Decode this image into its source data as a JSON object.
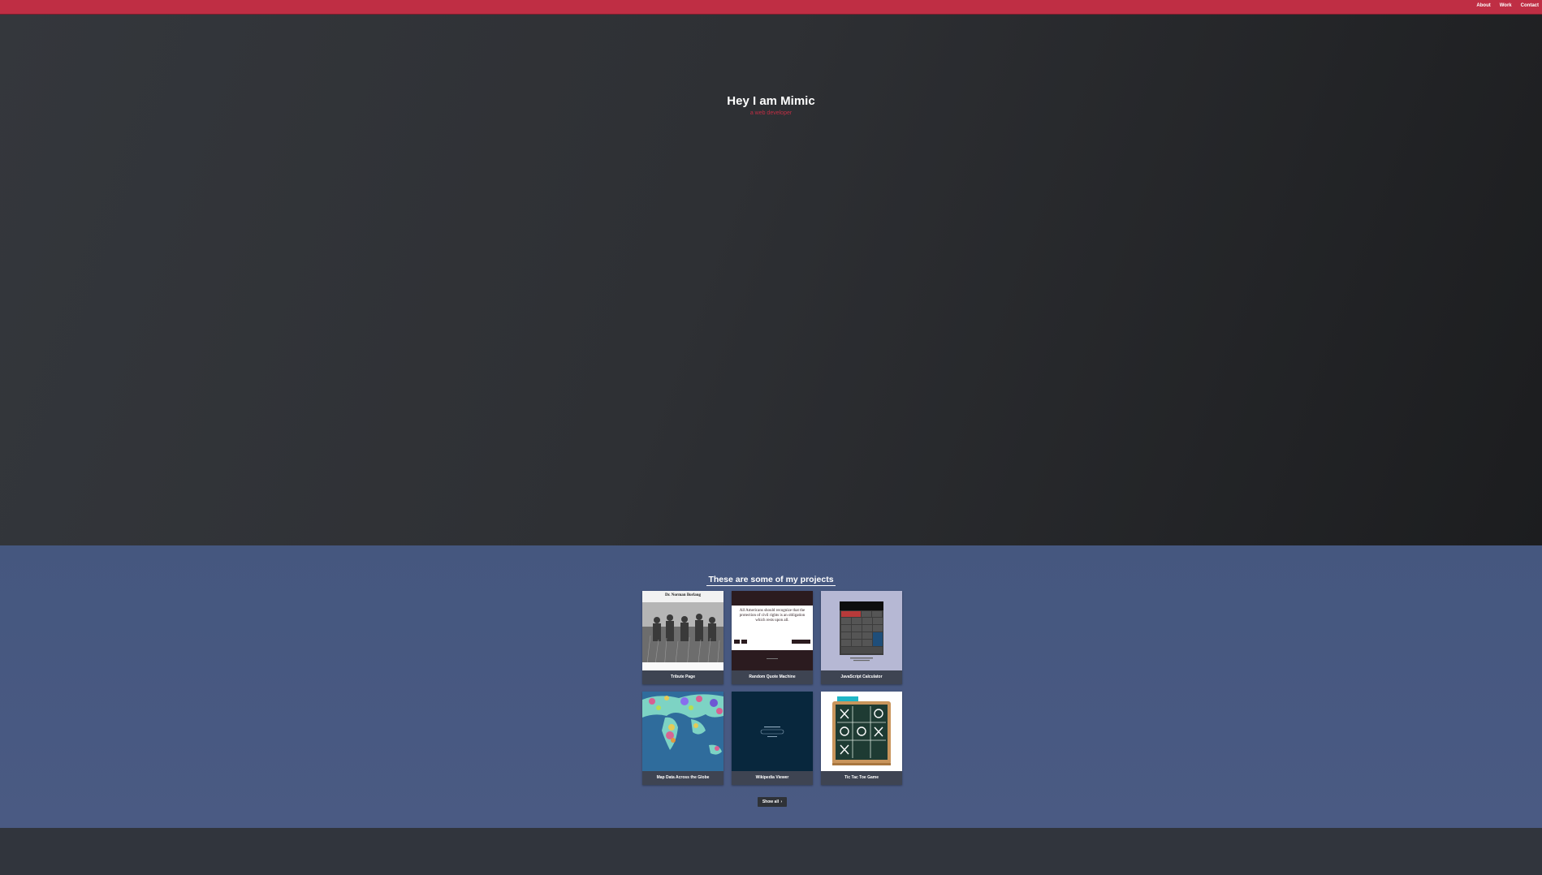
{
  "nav": {
    "links": [
      "About",
      "Work",
      "Contact"
    ]
  },
  "hero": {
    "title": "Hey I am Mimic",
    "subtitle": "a web developer"
  },
  "work": {
    "heading": "These are some of my projects",
    "projects": [
      {
        "label": "Tribute Page",
        "thumb_title": "Dr. Norman Borlaug"
      },
      {
        "label": "Random Quote Machine",
        "thumb_quote": "All Americans should recognize that the protection of civil rights is an obligation which rests upon all."
      },
      {
        "label": "JavaScript Calculator"
      },
      {
        "label": "Map Data Across the Globe"
      },
      {
        "label": "Wikipedia Viewer"
      },
      {
        "label": "Tic Tac Toe Game"
      }
    ],
    "show_all": "Show all"
  },
  "colors": {
    "accent": "#bf2e44",
    "work_bg": "#45577f",
    "hero_bg": "#2f3237"
  },
  "icons": {
    "show_all": "chevron-right-icon"
  }
}
